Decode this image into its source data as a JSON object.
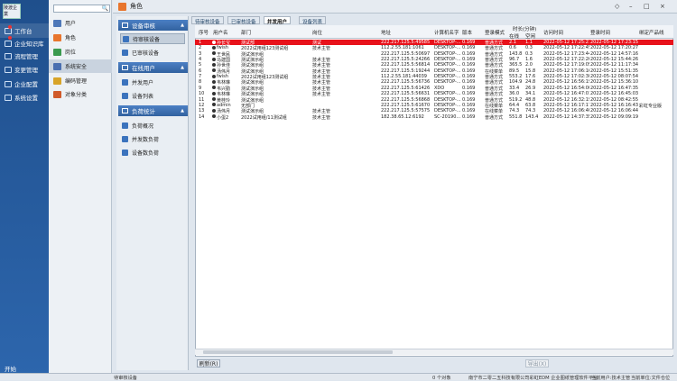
{
  "nav": {
    "logo_text": "陵渡企業",
    "items": [
      {
        "label": "工作台",
        "icon": "desktop-icon"
      },
      {
        "label": "企业知识库",
        "icon": "book-icon"
      },
      {
        "label": "流程管理",
        "icon": "flow-icon"
      },
      {
        "label": "变更管理",
        "icon": "refresh-icon"
      },
      {
        "label": "企业配置",
        "icon": "users-icon"
      },
      {
        "label": "系统设置",
        "icon": "gear-icon"
      }
    ],
    "start": "开始"
  },
  "sub": {
    "items": [
      {
        "label": "用户",
        "color": "#4e78b8"
      },
      {
        "label": "角色",
        "color": "#e8752d"
      },
      {
        "label": "岗位",
        "color": "#3a9a4e"
      },
      {
        "label": "系统安全",
        "color": "#4a6fb0"
      },
      {
        "label": "编码管理",
        "color": "#d8a428"
      },
      {
        "label": "对象分类",
        "color": "#d05a2a"
      }
    ]
  },
  "window": {
    "title": "角色",
    "buttons": [
      "◇",
      "–",
      "□",
      "×"
    ]
  },
  "panel": {
    "groups": [
      {
        "title": "设备审核",
        "items": [
          "待审核设备",
          "已审核设备"
        ]
      },
      {
        "title": "在线用户",
        "items": [
          "并发用户",
          "设备列表"
        ]
      },
      {
        "title": "负荷统计",
        "items": [
          "负荷概况",
          "并发数负荷",
          "设备数负荷"
        ]
      }
    ]
  },
  "tabs": [
    "待审核设备",
    "已审核设备",
    "并发用户",
    "设备列表"
  ],
  "table": {
    "headers": [
      "序号",
      "用户名",
      "部门",
      "岗位",
      "地址",
      "计算机名字",
      "版本",
      "登录模式",
      "在线",
      "空闲",
      "访问时间",
      "登录时间",
      "绑定产品线"
    ],
    "group_header": "时长(分钟)",
    "rows": [
      [
        "1",
        "孙长宝",
        "测试部",
        "测试",
        "222.217.125.5:49585",
        "DESKTOP-...",
        "0.169",
        "普通方式",
        "2.1",
        "1.1",
        "2022-05-12 17:25:21",
        "2022-05-12 17:23:15",
        ""
      ],
      [
        "2",
        "fwish",
        "2022试用组123测试组",
        "技术主管",
        "112.2.55.181:1061",
        "DESKTOP-...",
        "0.169",
        "普通方式",
        "0.6",
        "0.3",
        "2022-05-12 17:22:45",
        "2022-05-12 17:20:27",
        ""
      ],
      [
        "3",
        "王世民",
        "测试演示组",
        "",
        "222.217.125.5:50697",
        "DESKTOP-...",
        "0.169",
        "普通方式",
        "143.8",
        "0.3",
        "2022-05-12 17:23:44",
        "2022-05-12 14:57:16",
        ""
      ],
      [
        "4",
        "马建国",
        "测试演示组",
        "技术主管",
        "222.217.125.5:24266",
        "DESKTOP-...",
        "0.169",
        "普通方式",
        "96.7",
        "1.6",
        "2022-05-12 17:22:26",
        "2022-05-12 15:44:26",
        ""
      ],
      [
        "5",
        "孙世佳",
        "测试演示组",
        "技术主管",
        "222.217.125.5:56814",
        "DESKTOP-...",
        "0.169",
        "普通方式",
        "365.5",
        "2.0",
        "2022-05-12 17:19:05",
        "2022-05-12 11:17:34",
        ""
      ],
      [
        "6",
        "汤伟月",
        "测试演示组",
        "技术主管",
        "222.217.125.5:19244",
        "DESKTOP-...",
        "0.169",
        "在线菜单",
        "89.5",
        "15.8",
        "2022-05-12 17:06:16",
        "2022-05-12 15:51:35",
        ""
      ],
      [
        "7",
        "fwish",
        "2022试用组123测试组",
        "技术主管",
        "112.2.55.181:44039",
        "DESKTOP-...",
        "0.169",
        "普通方式",
        "553.2",
        "17.6",
        "2022-05-12 17:02:30",
        "2022-05-12 08:07:54",
        ""
      ],
      [
        "8",
        "韦林琳",
        "测试演示组",
        "技术主管",
        "222.217.125.5:56736",
        "DESKTOP-...",
        "0.169",
        "普通方式",
        "104.9",
        "24.8",
        "2022-05-12 16:56:19",
        "2022-05-12 15:36:10",
        ""
      ],
      [
        "9",
        "韦兴勤",
        "测试演示组",
        "技术主管",
        "222.217.125.5:61426",
        "XDO",
        "0.169",
        "普通方式",
        "33.4",
        "26.9",
        "2022-05-12 16:54:00",
        "2022-05-12 16:47:35",
        ""
      ],
      [
        "10",
        "韦林琳",
        "测试演示组",
        "技术主管",
        "222.217.125.5:56631",
        "DESKTOP-...",
        "0.169",
        "普通方式",
        "36.0",
        "34.1",
        "2022-05-12 16:47:01",
        "2022-05-12 16:45:03",
        ""
      ],
      [
        "11",
        "黄桂玲",
        "测试演示组",
        "",
        "222.217.125.5:56868",
        "DESKTOP-...",
        "0.169",
        "普通方式",
        "519.2",
        "48.8",
        "2022-05-12 16:32:19",
        "2022-05-12 08:42:55",
        ""
      ],
      [
        "12",
        "admin",
        "无部门",
        "",
        "222.217.125.5:61670",
        "DESKTOP-...",
        "0.169",
        "在线菜单",
        "64.4",
        "63.8",
        "2022-05-12 16:17:17",
        "2022-05-12 16:16:43",
        "彩虹专业版"
      ],
      [
        "13",
        "汤伟月",
        "测试演示组",
        "技术主管",
        "222.217.125.5:57575",
        "DESKTOP-...",
        "0.169",
        "在线菜单",
        "74.3",
        "74.3",
        "2022-05-12 16:06:40",
        "2022-05-12 16:06:44",
        ""
      ],
      [
        "14",
        "小蛋2",
        "2022试用组/11测试组",
        "技术主管",
        "182.38.65.12:6192",
        "SC-20190...",
        "0.169",
        "普通方式",
        "551.8",
        "143.4",
        "2022-05-12 14:37:35",
        "2022-05-12 09:09:19",
        ""
      ]
    ]
  },
  "buttons": {
    "refresh": "刷新(R)",
    "export": "导出(X)"
  },
  "status": {
    "left": "待审核设备",
    "count": "0 个对象",
    "company": "南宁市二零二五科技有限公司彩虹EDM 企业图纸管理软件平台",
    "user": "当前用户:技术主管",
    "unit": "当前单位:文件仓位"
  }
}
